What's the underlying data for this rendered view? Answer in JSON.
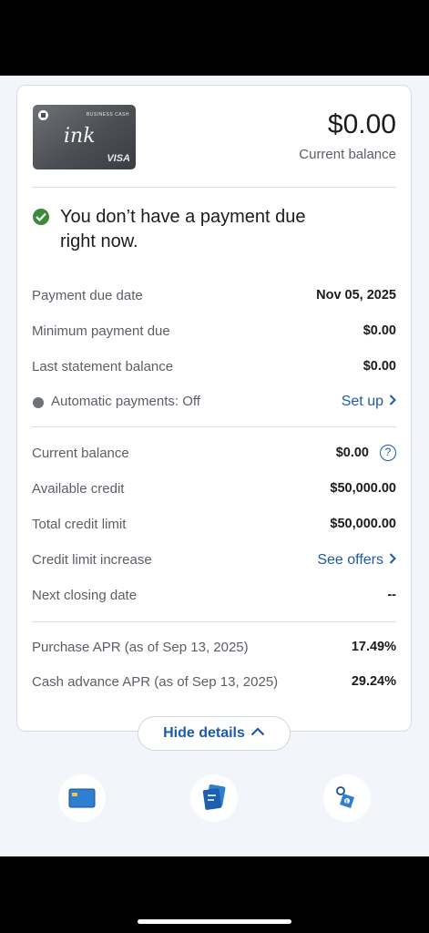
{
  "card": {
    "image_top_text": "BUSINESS CASH",
    "image_script": "ink",
    "image_network": "VISA",
    "balance_amount": "$0.00",
    "balance_label": "Current balance"
  },
  "payment_message": "You don’t have a payment due right now.",
  "payment_rows": [
    {
      "label": "Payment due date",
      "value": "Nov 05, 2025"
    },
    {
      "label": "Minimum payment due",
      "value": "$0.00"
    },
    {
      "label": "Last statement balance",
      "value": "$0.00"
    }
  ],
  "autopay": {
    "label": "Automatic payments: Off",
    "link": "Set up"
  },
  "credit_rows": [
    {
      "label": "Current balance",
      "value": "$0.00"
    },
    {
      "label": "Available credit",
      "value": "$50,000.00"
    },
    {
      "label": "Total credit limit",
      "value": "$50,000.00"
    }
  ],
  "limit_increase": {
    "label": "Credit limit increase",
    "link": "See offers"
  },
  "next_closing": {
    "label": "Next closing date",
    "value": "--"
  },
  "apr_rows": [
    {
      "label": "Purchase APR (as of Sep 13, 2025)",
      "value": "17.49%"
    },
    {
      "label": "Cash advance APR (as of Sep 13, 2025)",
      "value": "29.24%"
    }
  ],
  "hide_details_label": "Hide details",
  "colors": {
    "accent": "#1e5aa6",
    "success": "#3e8a3c",
    "muted": "#6e7277"
  },
  "nav_icons": [
    "card-icon",
    "document-icon",
    "tag-icon"
  ]
}
